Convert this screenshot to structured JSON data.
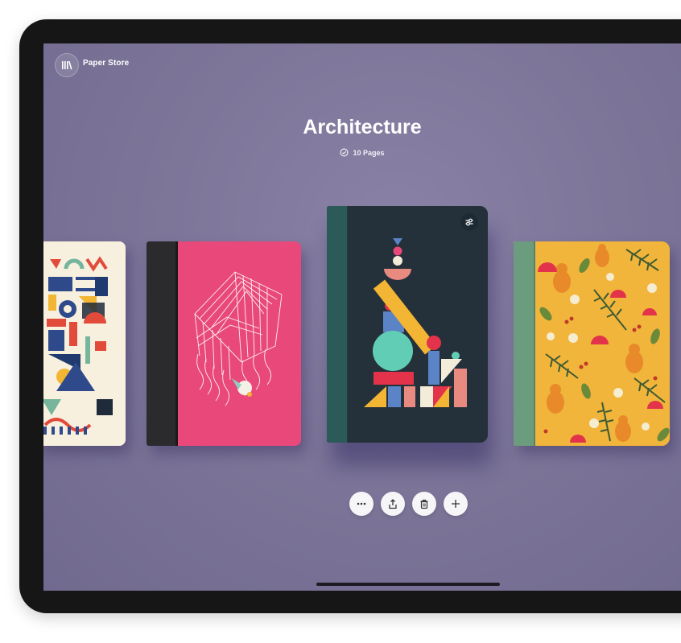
{
  "header": {
    "store_label": "Paper Store",
    "library_icon": "library-books-icon"
  },
  "notebook": {
    "title": "Architecture",
    "pages": "10 Pages",
    "pages_icon": "check-circle-icon"
  },
  "covers": [
    {
      "name": "geometric-pattern-cover",
      "color": "#f7f0df"
    },
    {
      "name": "pink-sketch-cover",
      "color": "#e8497a"
    },
    {
      "name": "architecture-cover",
      "color": "#24303a"
    },
    {
      "name": "pear-pattern-cover",
      "color": "#f0b53a"
    }
  ],
  "actions": [
    {
      "name": "more-button",
      "icon": "ellipsis-icon"
    },
    {
      "name": "share-button",
      "icon": "share-icon"
    },
    {
      "name": "delete-button",
      "icon": "trash-icon"
    },
    {
      "name": "add-button",
      "icon": "plus-icon"
    }
  ],
  "colors": {
    "background": "#7d7699",
    "device_frame": "#161616",
    "action_button": "#f6f6f8"
  }
}
